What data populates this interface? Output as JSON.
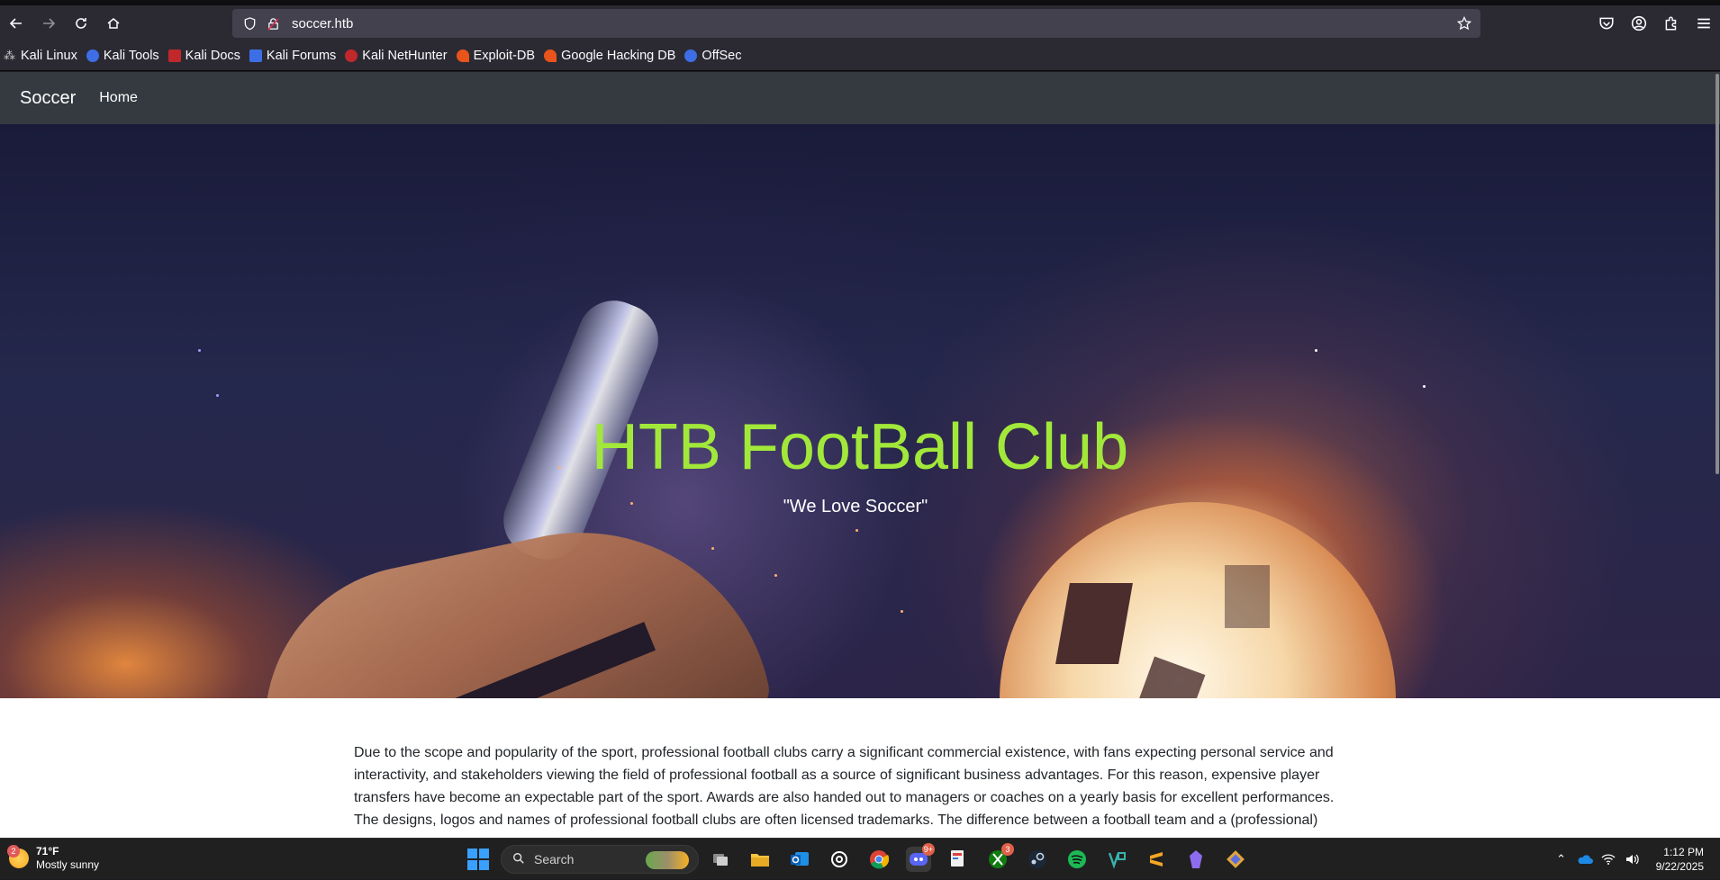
{
  "browser": {
    "url": "soccer.htb",
    "bookmarks": [
      {
        "label": "Kali Linux",
        "color": "#222222"
      },
      {
        "label": "Kali Tools",
        "color": "#3d6ee6"
      },
      {
        "label": "Kali Docs",
        "color": "#c0282c"
      },
      {
        "label": "Kali Forums",
        "color": "#3d6ee6"
      },
      {
        "label": "Kali NetHunter",
        "color": "#c0282c"
      },
      {
        "label": "Exploit-DB",
        "color": "#e8541c"
      },
      {
        "label": "Google Hacking DB",
        "color": "#e8541c"
      },
      {
        "label": "OffSec",
        "color": "#3d6ee6"
      }
    ]
  },
  "site": {
    "brand": "Soccer",
    "nav_home": "Home",
    "hero_title": "HTB FootBall Club",
    "hero_subtitle": "\"We Love Soccer\"",
    "body_text": "Due to the scope and popularity of the sport, professional football clubs carry a significant commercial existence, with fans expecting personal service and interactivity, and stakeholders viewing the field of professional football as a source of significant business advantages. For this reason, expensive player transfers have become an expectable part of the sport. Awards are also handed out to managers or coaches on a yearly basis for excellent performances. The designs, logos and names of professional football clubs are often licensed trademarks. The difference between a football team and a (professional)"
  },
  "taskbar": {
    "weather_badge": "2",
    "temperature": "71°F",
    "condition": "Mostly sunny",
    "search_label": "Search",
    "discord_badge": "9+",
    "xbox_badge": "3",
    "time": "1:12 PM",
    "date": "9/22/2025"
  },
  "colors": {
    "hero_title": "#a2e83a",
    "nav_bg": "#343a40",
    "browser_bg": "#2b2a33"
  }
}
